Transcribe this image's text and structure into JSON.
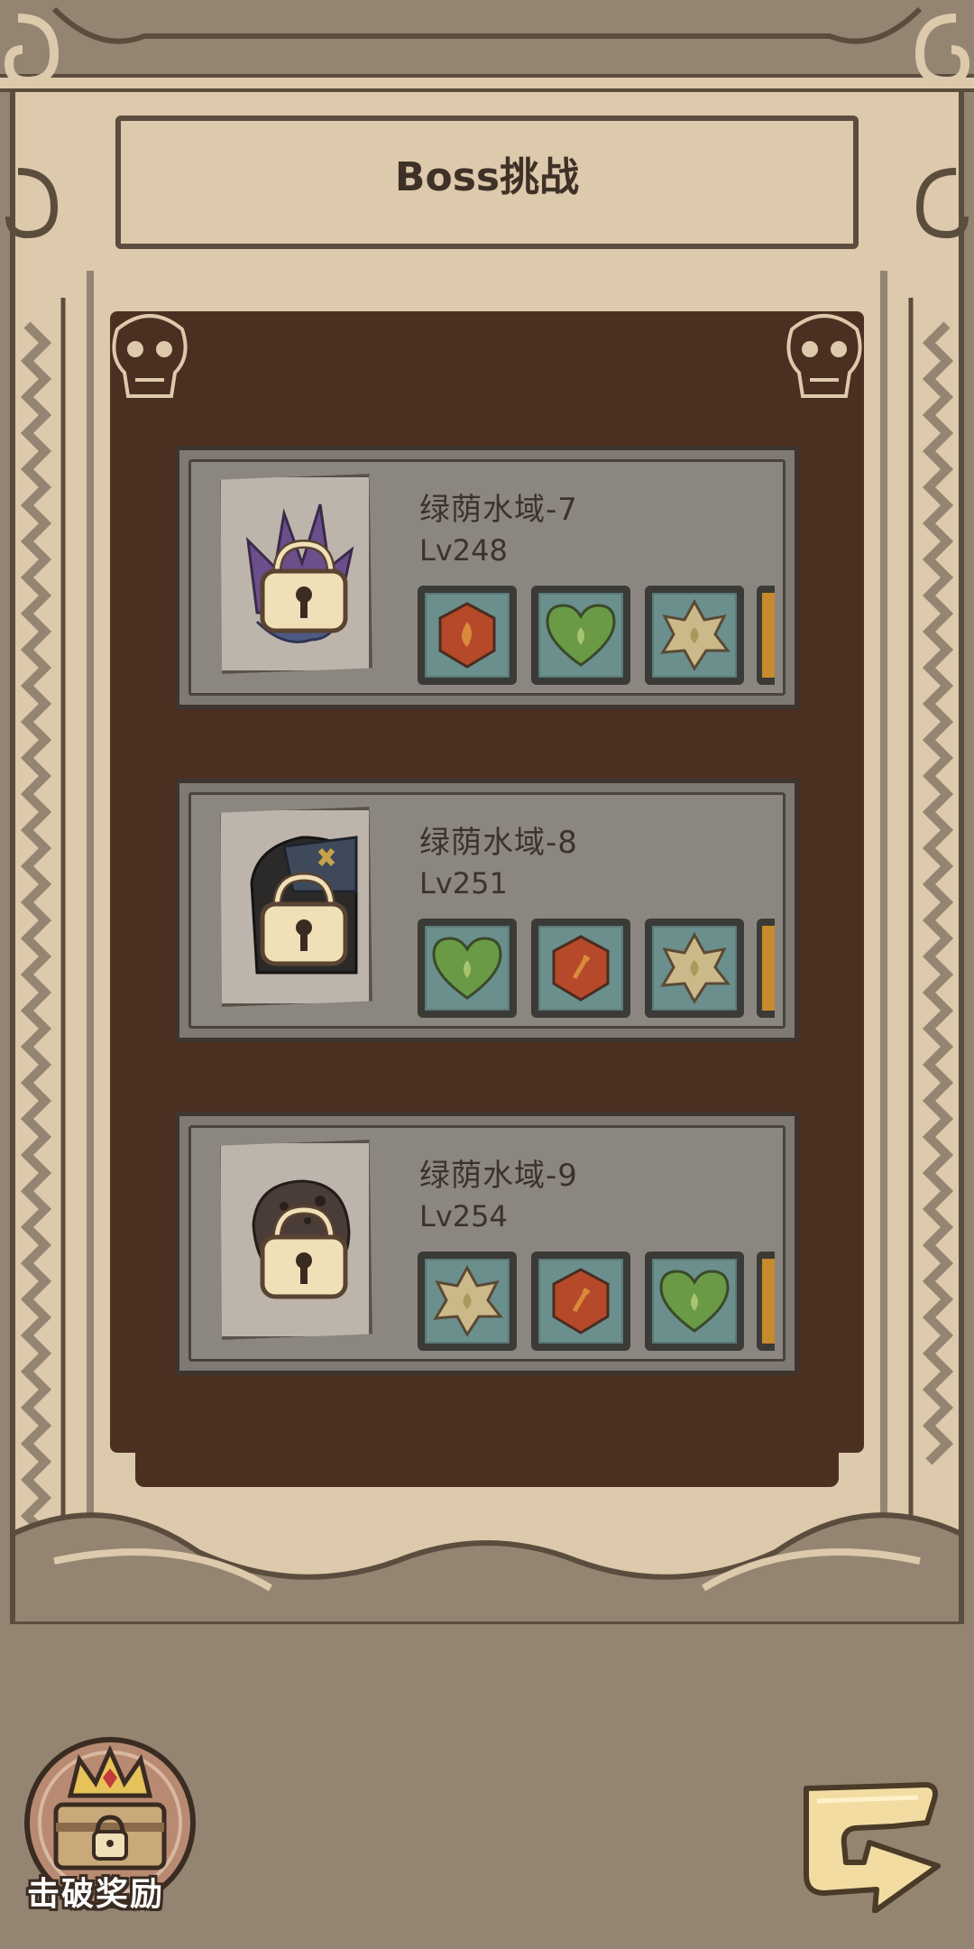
{
  "header": {
    "title": "Boss挑战"
  },
  "bosses": [
    {
      "name": "绿荫水域-7",
      "level": "Lv248",
      "portrait_icon": "purple-crystal-boss-icon",
      "elements": [
        "fire-hexagon-icon",
        "leaf-heart-icon",
        "earth-star-icon"
      ],
      "locked": true
    },
    {
      "name": "绿荫水域-8",
      "level": "Lv251",
      "portrait_icon": "hooded-figure-boss-icon",
      "elements": [
        "leaf-heart-icon",
        "fire-hexagon-icon",
        "earth-star-icon"
      ],
      "locked": true
    },
    {
      "name": "绿荫水域-9",
      "level": "Lv254",
      "portrait_icon": "rock-golem-boss-icon",
      "elements": [
        "earth-star-icon",
        "fire-hexagon-icon",
        "leaf-heart-icon"
      ],
      "locked": true
    }
  ],
  "footer": {
    "reward_label": "击破奖励",
    "reward_icon": "treasure-chest-crown-icon",
    "back_icon": "return-arrow-icon"
  },
  "colors": {
    "background": "#938571",
    "frame": "#ddc9ab",
    "board": "#4b3022",
    "card": "#8c8680",
    "tile": "#6b8f8c",
    "fire": "#b5492a",
    "leaf": "#6a9a46",
    "earth": "#cbb98a"
  }
}
